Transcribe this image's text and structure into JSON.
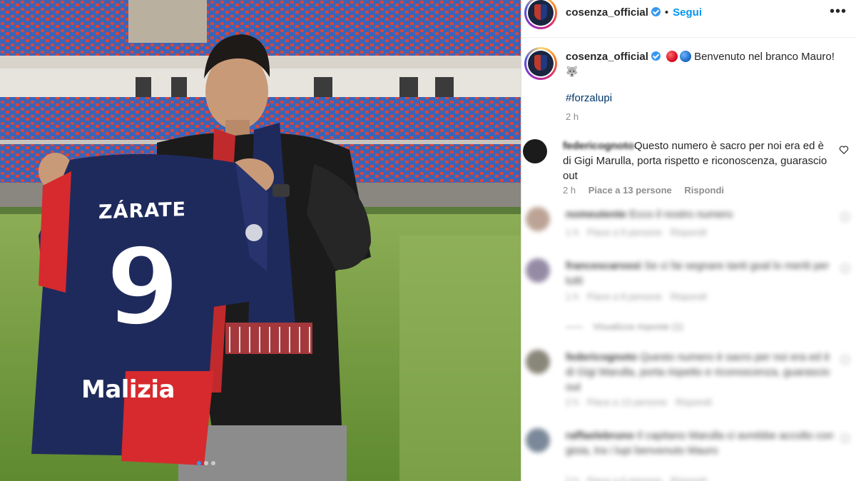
{
  "post": {
    "username": "cosenza_official",
    "header_separator": "•",
    "follow_label": "Segui",
    "more_label": "•••"
  },
  "caption": {
    "username": "cosenza_official",
    "text": "Benvenuto nel branco Mauro!",
    "wolf_emoji": "🐺",
    "hashtag": "#forzalupi",
    "time": "2 h"
  },
  "photo": {
    "shirt_name": "ZÁRATE",
    "shirt_number": "9",
    "sponsor": "Malizia",
    "slides": 3,
    "active_slide": 1
  },
  "comments": [
    {
      "username": "federicognoto",
      "text": "Questo numero è sacro per noi era ed è di Gigi Marulla, porta rispetto e riconoscenza, guarascio out",
      "time": "2 h",
      "likes": "Piace a 13 persone",
      "reply_label": "Rispondi"
    }
  ],
  "blurred_comments": [
    {
      "username": "nomeutente",
      "text": "Ecco il nostro numero",
      "time": "1 h",
      "likes": "Piace a 9 persone",
      "reply_label": "Rispondi",
      "avatar_color": "#b59a8a"
    },
    {
      "username": "francescarossi",
      "text": "Se ci fai segnare tanti goal lo meriti per tutti",
      "time": "1 h",
      "likes": "Piace a 8 persone",
      "reply_label": "Rispondi",
      "avatar_color": "#8a7f9c",
      "replies": "Visualizza risposte (1)"
    },
    {
      "username": "federicognoto",
      "text": "Questo numero è sacro per noi era ed è di Gigi Marulla, porta rispetto e riconoscenza, guarascio out",
      "time": "2 h",
      "likes": "Piace a 13 persone",
      "reply_label": "Rispondi",
      "avatar_color": "#7d7a6c"
    },
    {
      "username": "raffaelebruno",
      "text": "Il capitano Marulla ci avrebbe accolto con gioia, tra i lupi benvenuto Mauro",
      "time": "2 h",
      "likes": "Piace a 6 persone",
      "reply_label": "Rispondi",
      "avatar_color": "#6c7c8e"
    }
  ],
  "colors": {
    "follow_blue": "#0095f6",
    "hashtag_blue": "#00376b",
    "meta_gray": "#8e8e8e",
    "shirt_navy": "#1f2a5c",
    "shirt_red": "#d62a2e"
  }
}
